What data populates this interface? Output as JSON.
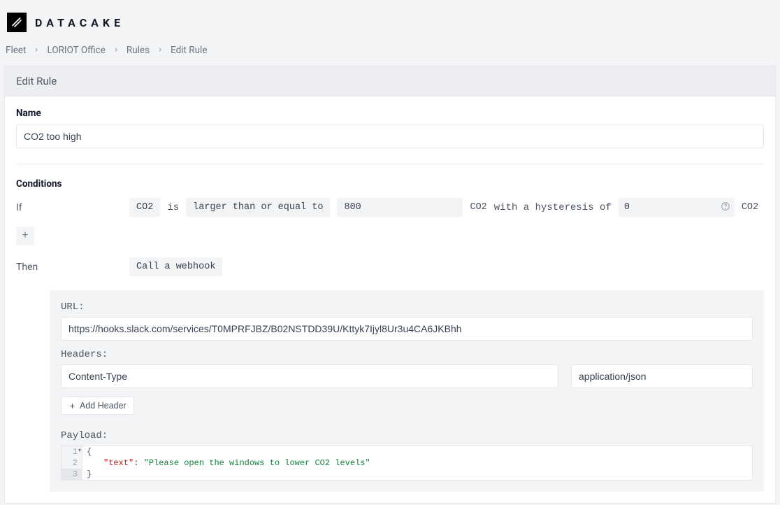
{
  "brand": {
    "name": "DATACAKE"
  },
  "breadcrumb": [
    {
      "label": "Fleet"
    },
    {
      "label": "LORIOT Office"
    },
    {
      "label": "Rules"
    },
    {
      "label": "Edit Rule"
    }
  ],
  "panel": {
    "title": "Edit Rule"
  },
  "name": {
    "label": "Name",
    "value": "CO2 too high"
  },
  "conditions": {
    "label": "Conditions",
    "if_kw": "If",
    "field": "CO2",
    "is_kw": "is",
    "operator": "larger than or equal to",
    "value": "800",
    "unit_after_value": "CO2",
    "hysteresis_kw": "with a hysteresis of",
    "hysteresis_value": "0",
    "unit_after_hyst": "CO2",
    "add_label": "+"
  },
  "then": {
    "kw": "Then",
    "action": "Call a webhook",
    "url_label": "URL:",
    "url_value": "https://hooks.slack.com/services/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",
    "headers_label": "Headers:",
    "header_key": "Content-Type",
    "header_value": "application/json",
    "add_header_label": "Add Header",
    "payload_label": "Payload:",
    "payload_lines": {
      "l1_num": "1",
      "l1_brace": "{",
      "l2_num": "2",
      "l2_key": "\"text\"",
      "l2_colon": ": ",
      "l2_val": "\"Please open the windows to lower CO2 levels\"",
      "l3_num": "3",
      "l3_brace": "}"
    }
  }
}
